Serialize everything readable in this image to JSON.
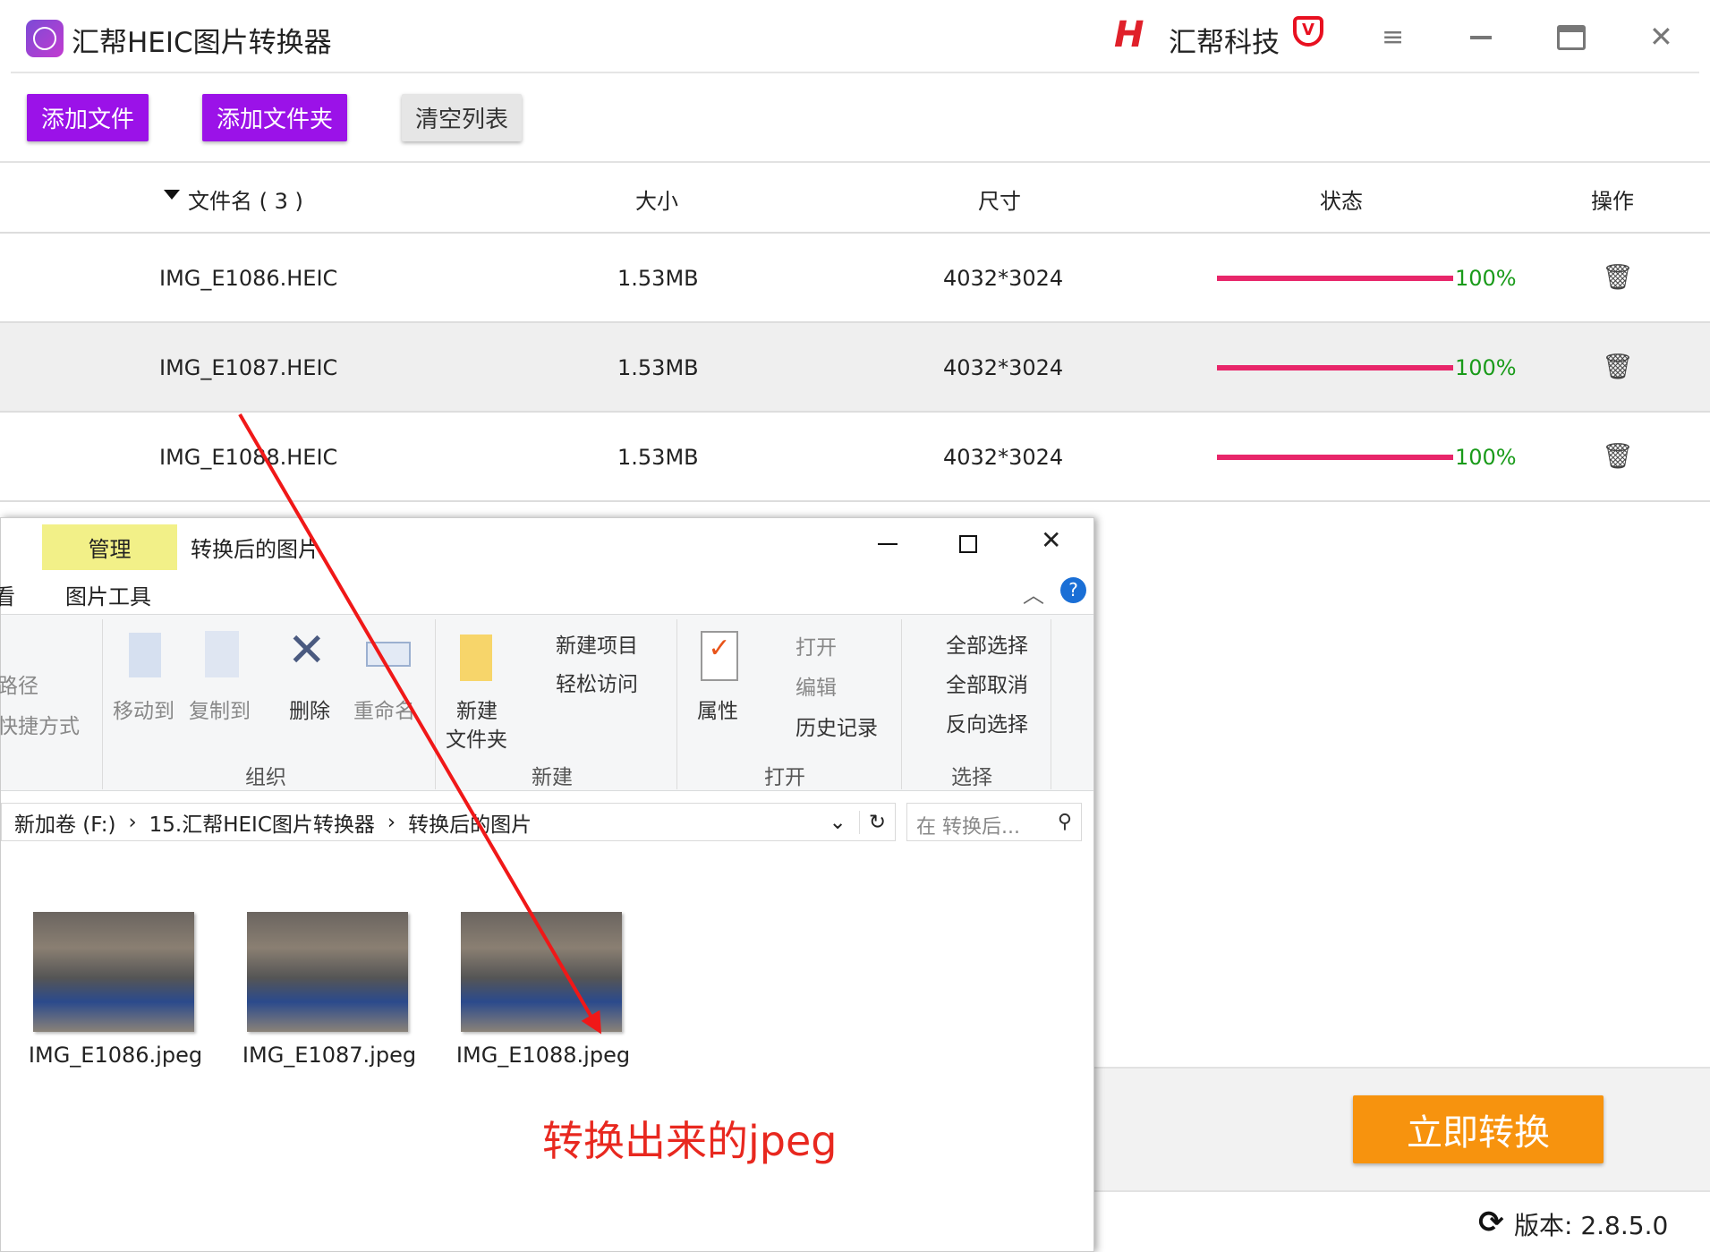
{
  "app": {
    "title": "汇帮HEIC图片转换器",
    "brand": "汇帮科技",
    "logo_text": "HEIC"
  },
  "toolbar": {
    "add_file": "添加文件",
    "add_folder": "添加文件夹",
    "clear_list": "清空列表"
  },
  "table": {
    "headers": {
      "name": "文件名 ( 3 )",
      "size": "大小",
      "dims": "尺寸",
      "status": "状态",
      "action": "操作"
    },
    "rows": [
      {
        "name": "IMG_E1086.HEIC",
        "size": "1.53MB",
        "dims": "4032*3024",
        "progress": "100%"
      },
      {
        "name": "IMG_E1087.HEIC",
        "size": "1.53MB",
        "dims": "4032*3024",
        "progress": "100%"
      },
      {
        "name": "IMG_E1088.HEIC",
        "size": "1.53MB",
        "dims": "4032*3024",
        "progress": "100%"
      }
    ]
  },
  "explorer": {
    "context_tab": "管理",
    "title": "转换后的图片",
    "tab_view": "看",
    "tab_picture_tools": "图片工具",
    "ribbon": {
      "path": "路径",
      "shortcut": "快捷方式",
      "move_to": "移动到",
      "copy_to": "复制到",
      "delete": "删除",
      "rename": "重命名",
      "new_folder_1": "新建",
      "new_folder_2": "文件夹",
      "new_item": "新建项目",
      "easy_access": "轻松访问",
      "properties": "属性",
      "open": "打开",
      "edit": "编辑",
      "history": "历史记录",
      "select_all": "全部选择",
      "select_none": "全部取消",
      "invert": "反向选择",
      "groups": {
        "organize": "组织",
        "new": "新建",
        "open": "打开",
        "select": "选择"
      }
    },
    "breadcrumb": [
      "新加卷 (F:)",
      "15.汇帮HEIC图片转换器",
      "转换后的图片"
    ],
    "search_placeholder": "在 转换后...",
    "files": [
      "IMG_E1086.jpeg",
      "IMG_E1087.jpeg",
      "IMG_E1088.jpeg"
    ]
  },
  "annotation": "转换出来的jpeg",
  "convert_button": "立即转换",
  "version": "版本:  2.8.5.0",
  "colors": {
    "purple": "#9b12e8",
    "progress": "#e8266a",
    "orange": "#f7930e",
    "annotation": "#e8281f"
  }
}
